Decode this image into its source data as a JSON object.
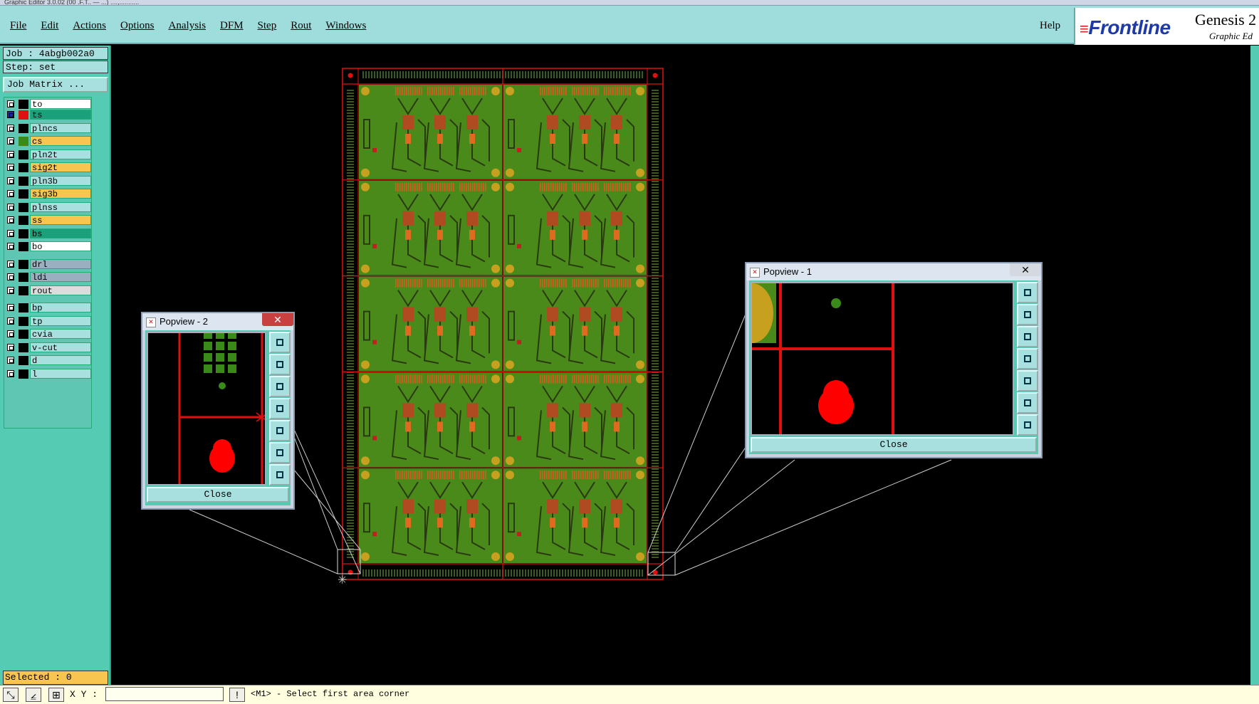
{
  "window": {
    "title": "Graphic Editor 3.0.02 (00 .F.T.. — ...) ....,..........."
  },
  "menu": {
    "items": [
      {
        "label": "File"
      },
      {
        "label": "Edit"
      },
      {
        "label": "Actions"
      },
      {
        "label": "Options"
      },
      {
        "label": "Analysis"
      },
      {
        "label": "DFM"
      },
      {
        "label": "Step"
      },
      {
        "label": "Rout"
      },
      {
        "label": "Windows"
      }
    ],
    "help": "Help"
  },
  "brand": {
    "logo": "Frontline",
    "title": "Genesis 2",
    "subtitle": "Graphic Ed"
  },
  "job": {
    "job_line": "Job : 4abgb002a0",
    "step_line": "Step: set",
    "matrix_button": "Job Matrix ..."
  },
  "layers": [
    {
      "name": "to",
      "color": "#ffffff",
      "swatch": "#000000"
    },
    {
      "name": "ts",
      "color": "#1aa07a",
      "swatch": "#e01010",
      "active": true
    },
    {
      "name": "plncs",
      "color": "#a8e0e0",
      "swatch": "#000000"
    },
    {
      "name": "cs",
      "color": "#f7c550",
      "swatch": "#3a8a1a"
    },
    {
      "name": "pln2t",
      "color": "#a8e0e0",
      "swatch": "#000000"
    },
    {
      "name": "sig2t",
      "color": "#f7c550",
      "swatch": "#000000"
    },
    {
      "name": "pln3b",
      "color": "#a8e0e0",
      "swatch": "#000000"
    },
    {
      "name": "sig3b",
      "color": "#f7c550",
      "swatch": "#000000"
    },
    {
      "name": "plnss",
      "color": "#a8e0e0",
      "swatch": "#000000"
    },
    {
      "name": "ss",
      "color": "#f7c550",
      "swatch": "#000000"
    },
    {
      "name": "bs",
      "color": "#1aa07a",
      "swatch": "#000000"
    },
    {
      "name": "bo",
      "color": "#ffffff",
      "swatch": "#000000"
    },
    {
      "name": "drl",
      "color": "#9ab0c0",
      "swatch": "#000000"
    },
    {
      "name": "ldi",
      "color": "#9ab0c0",
      "swatch": "#000000"
    },
    {
      "name": "rout",
      "color": "#dcdcdc",
      "swatch": "#000000"
    },
    {
      "name": "bp",
      "color": "#a8e0e0",
      "swatch": "#000000"
    },
    {
      "name": "tp",
      "color": "#a8e0e0",
      "swatch": "#000000"
    },
    {
      "name": "cvia",
      "color": "#a8e0e0",
      "swatch": "#000000"
    },
    {
      "name": "v-cut",
      "color": "#a8e0e0",
      "swatch": "#000000"
    },
    {
      "name": "d",
      "color": "#a8e0e0",
      "swatch": "#000000"
    },
    {
      "name": "l",
      "color": "#a8e0e0",
      "swatch": "#000000"
    }
  ],
  "selected": "Selected : 0",
  "status": {
    "xy_label": "X Y :",
    "xy_value": "",
    "prompt": "<M1> - Select first area corner"
  },
  "popview1": {
    "title": "Popview - 1",
    "close_label": "Close",
    "close_x": "✕"
  },
  "popview2": {
    "title": "Popview - 2",
    "close_label": "Close",
    "close_x": "✕"
  },
  "colors": {
    "board": "#4a8a1a",
    "pad": "#c8a020",
    "trace": "#2a3a10",
    "outline": "#e01010",
    "accent": "#56cbb3"
  }
}
